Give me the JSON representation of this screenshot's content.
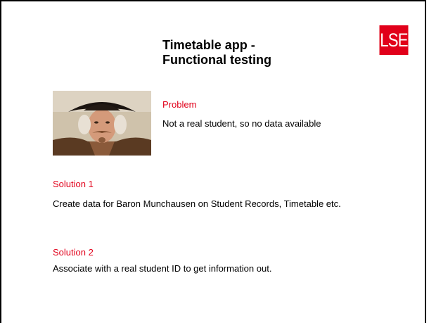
{
  "slide": {
    "title_line1": "Timetable app -",
    "title_line2": "Functional testing",
    "logo_text": "LSE",
    "brand_color": "#e1001a",
    "problem": {
      "label": "Problem",
      "text": "Not a real student, so no data available"
    },
    "solution1": {
      "label": "Solution 1",
      "text": "Create data for Baron Munchausen on Student Records, Timetable etc."
    },
    "solution2": {
      "label": "Solution 2",
      "text": "Associate with a real student ID to get information out."
    }
  }
}
